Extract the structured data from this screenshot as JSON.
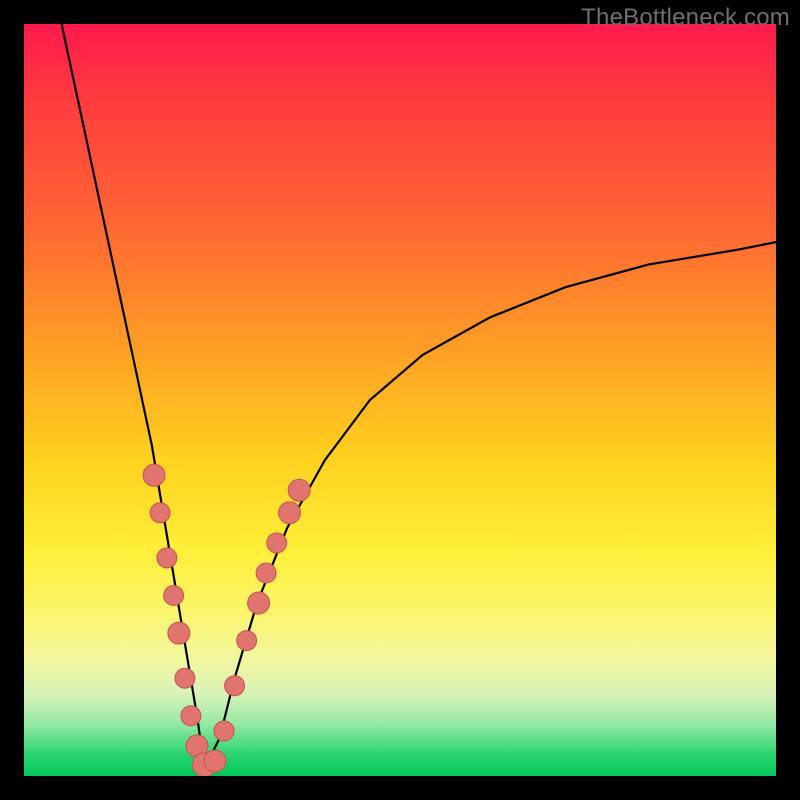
{
  "watermark": "TheBottleneck.com",
  "colors": {
    "frame": "#000000",
    "gradient_top": "#ff1a4d",
    "gradient_mid": "#ffd21f",
    "gradient_bottom": "#00c85c",
    "curve": "#000000",
    "dot_fill": "#e0746e",
    "dot_stroke": "#c6544f"
  },
  "chart_data": {
    "type": "line",
    "title": "",
    "xlabel": "",
    "ylabel": "",
    "xlim": [
      0,
      100
    ],
    "ylim": [
      0,
      100
    ],
    "comment": "V-shaped bottleneck curve; minimum near x≈24; left branch steep, right branch asymptotes near y≈70.",
    "series": [
      {
        "name": "bottleneck-curve",
        "x": [
          5,
          8,
          11,
          14,
          17,
          19,
          21,
          23,
          24,
          26,
          28,
          31,
          35,
          40,
          46,
          53,
          62,
          72,
          83,
          95,
          100
        ],
        "y": [
          100,
          86,
          72,
          58,
          44,
          32,
          20,
          8,
          1,
          5,
          13,
          23,
          33,
          42,
          50,
          56,
          61,
          65,
          68,
          70,
          71
        ]
      }
    ],
    "markers": [
      {
        "x": 17.3,
        "y": 40,
        "r": 11
      },
      {
        "x": 18.1,
        "y": 35,
        "r": 10
      },
      {
        "x": 19.0,
        "y": 29,
        "r": 10
      },
      {
        "x": 19.9,
        "y": 24,
        "r": 10
      },
      {
        "x": 20.6,
        "y": 19,
        "r": 11
      },
      {
        "x": 21.4,
        "y": 13,
        "r": 10
      },
      {
        "x": 22.2,
        "y": 8,
        "r": 10
      },
      {
        "x": 23.0,
        "y": 4,
        "r": 11
      },
      {
        "x": 24.0,
        "y": 1.5,
        "r": 12
      },
      {
        "x": 25.4,
        "y": 2,
        "r": 11
      },
      {
        "x": 26.6,
        "y": 6,
        "r": 10
      },
      {
        "x": 28.0,
        "y": 12,
        "r": 10
      },
      {
        "x": 29.6,
        "y": 18,
        "r": 10
      },
      {
        "x": 31.2,
        "y": 23,
        "r": 11
      },
      {
        "x": 32.2,
        "y": 27,
        "r": 10
      },
      {
        "x": 33.6,
        "y": 31,
        "r": 10
      },
      {
        "x": 35.3,
        "y": 35,
        "r": 11
      },
      {
        "x": 36.6,
        "y": 38,
        "r": 11
      }
    ]
  }
}
